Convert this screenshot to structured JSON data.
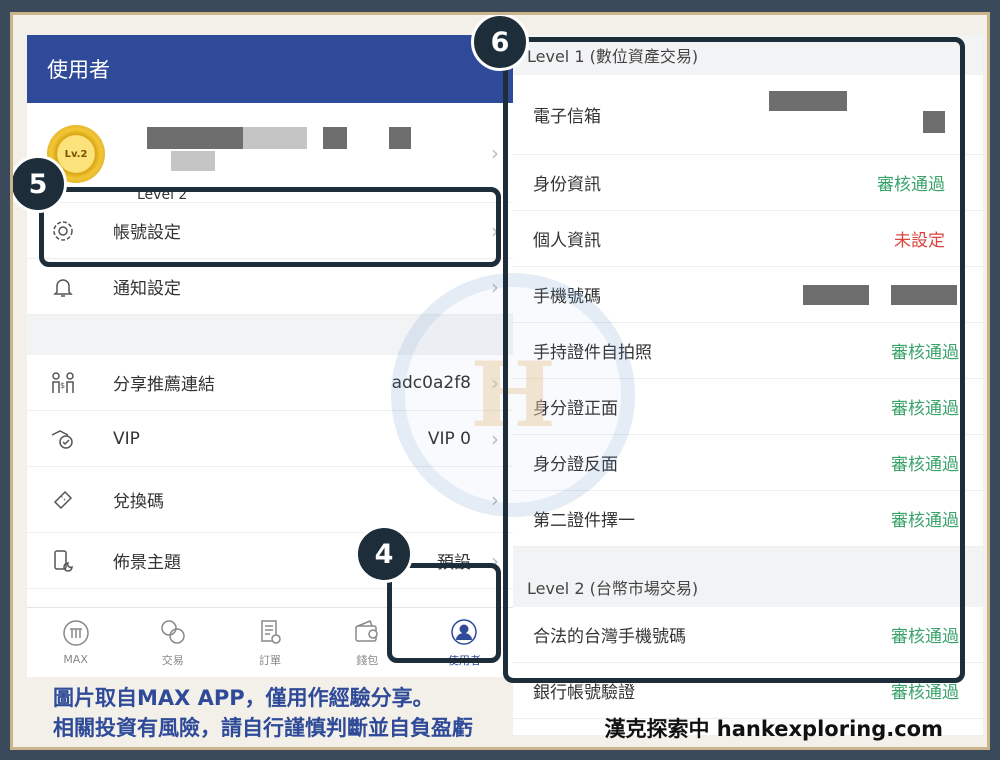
{
  "left_panel": {
    "header_title": "使用者",
    "profile": {
      "badge_text": "Lv.2",
      "level_text": "Level 2"
    },
    "menu": [
      {
        "label": "帳號設定",
        "value": ""
      },
      {
        "label": "通知設定",
        "value": ""
      }
    ],
    "menu2": [
      {
        "label": "分享推薦連結",
        "value": "adc0a2f8"
      },
      {
        "label": "VIP",
        "value": "VIP 0"
      },
      {
        "label": "兌換碼",
        "value": ""
      },
      {
        "label": "佈景主題",
        "value": "預設"
      }
    ],
    "tabs": [
      {
        "label": "MAX",
        "icon": "max-logo-icon"
      },
      {
        "label": "交易",
        "icon": "exchange-icon"
      },
      {
        "label": "訂單",
        "icon": "order-icon"
      },
      {
        "label": "錢包",
        "icon": "wallet-icon"
      },
      {
        "label": "使用者",
        "icon": "user-icon",
        "active": true
      }
    ]
  },
  "right_panel": {
    "section1_title": "Level 1 (數位資產交易)",
    "section1_rows": [
      {
        "label": "電子信箱",
        "value": "",
        "status": "hidden"
      },
      {
        "label": "身份資訊",
        "value": "審核通過",
        "status": "ok"
      },
      {
        "label": "個人資訊",
        "value": "未設定",
        "status": "bad"
      },
      {
        "label": "手機號碼",
        "value": "",
        "status": "hidden"
      },
      {
        "label": "手持證件自拍照",
        "value": "審核通過",
        "status": "ok"
      },
      {
        "label": "身分證正面",
        "value": "審核通過",
        "status": "ok"
      },
      {
        "label": "身分證反面",
        "value": "審核通過",
        "status": "ok"
      },
      {
        "label": "第二證件擇一",
        "value": "審核通過",
        "status": "ok"
      }
    ],
    "section2_title": "Level 2 (台幣市場交易)",
    "section2_rows": [
      {
        "label": "合法的台灣手機號碼",
        "value": "審核通過",
        "status": "ok"
      },
      {
        "label": "銀行帳號驗證",
        "value": "審核通過",
        "status": "ok"
      }
    ]
  },
  "callouts": [
    "4",
    "5",
    "6"
  ],
  "caption": {
    "line1": "圖片取自MAX APP，僅用作經驗分享。",
    "line2": "相關投資有風險，請自行謹慎判斷並自負盈虧"
  },
  "brand": "漢克探索中 hankexploring.com",
  "colors": {
    "header": "#2f4a98",
    "ok": "#3aa36b",
    "bad": "#d9443c",
    "callout": "#1d2e3a",
    "frame": "#c9b48c"
  }
}
